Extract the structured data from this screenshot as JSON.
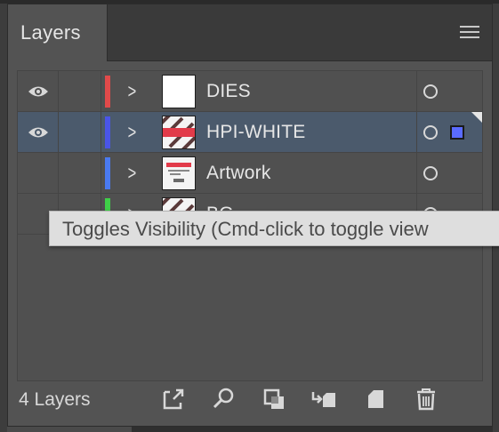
{
  "panel": {
    "tab_label": "Layers",
    "menu_icon": "hamburger-menu-icon"
  },
  "layers": [
    {
      "name": "DIES",
      "visible": true,
      "color": "#e24a4a",
      "thumbnail": "blank",
      "selected": false,
      "partially_hidden": false
    },
    {
      "name": "HPI-WHITE",
      "visible": true,
      "color": "#4a55e8",
      "thumbnail": "striped-red-band",
      "selected": true,
      "partially_hidden": false
    },
    {
      "name": "Artwork",
      "visible": false,
      "color": "#4a7af0",
      "thumbnail": "artwork-preview",
      "selected": false,
      "partially_hidden": false
    },
    {
      "name": "BG",
      "visible": false,
      "color": "#3fd048",
      "thumbnail": "striped",
      "selected": false,
      "partially_hidden": true
    }
  ],
  "tooltip": {
    "text": "Toggles Visibility (Cmd-click to toggle view"
  },
  "footer": {
    "count_label": "4 Layers",
    "buttons": [
      {
        "name": "export-icon",
        "title": "Collect for Export"
      },
      {
        "name": "search-icon",
        "title": "Locate Object"
      },
      {
        "name": "clipping-mask-icon",
        "title": "Make/Release Clipping Mask"
      },
      {
        "name": "new-sublayer-icon",
        "title": "Create New Sublayer"
      },
      {
        "name": "new-layer-icon",
        "title": "Create New Layer"
      },
      {
        "name": "trash-icon",
        "title": "Delete Selection"
      }
    ]
  }
}
